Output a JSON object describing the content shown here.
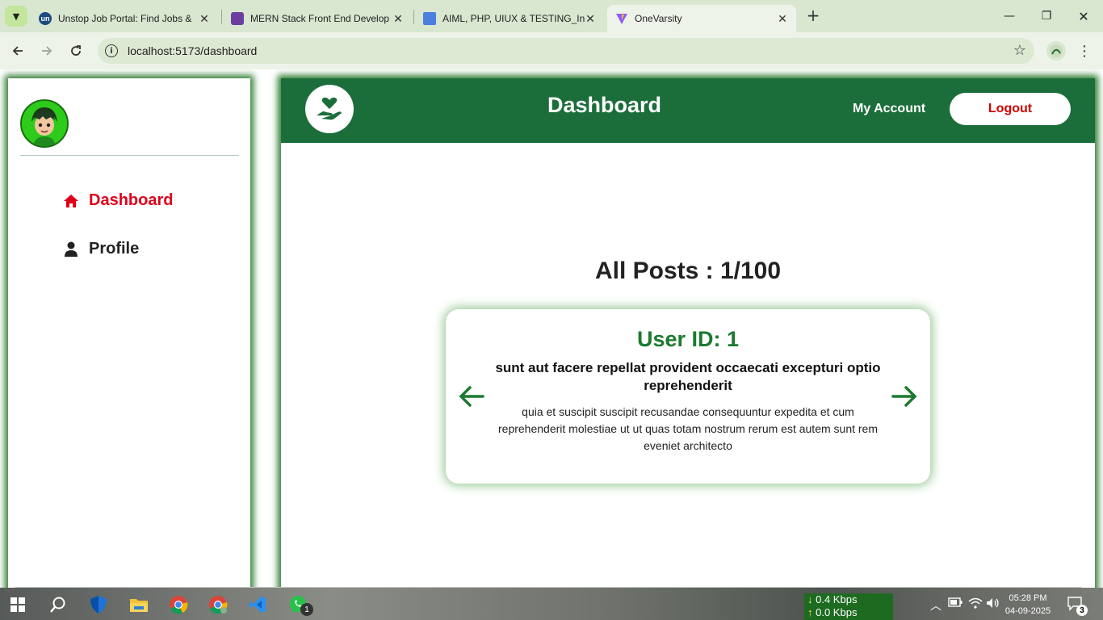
{
  "browser": {
    "tabs": [
      {
        "title": "Unstop Job Portal: Find Jobs &",
        "favicon_text": "un",
        "favicon_color": "#1c4980"
      },
      {
        "title": "MERN Stack Front End Develop",
        "favicon_color": "#6b3fa0"
      },
      {
        "title": "AIML, PHP, UIUX & TESTING_Int",
        "favicon_color": "#4a7fe0"
      },
      {
        "title": "OneVarsity",
        "favicon_color": "#f2b705"
      }
    ],
    "url": "localhost:5173/dashboard"
  },
  "sidebar": {
    "items": [
      {
        "label": "Dashboard",
        "icon": "home-icon",
        "color": "#e0001b"
      },
      {
        "label": "Profile",
        "icon": "user-icon",
        "color": "#222222"
      }
    ]
  },
  "header": {
    "title": "Dashboard",
    "my_account": "My Account",
    "logout": "Logout"
  },
  "posts": {
    "heading": "All Posts : 1/100",
    "card": {
      "user": "User ID: 1",
      "title": "sunt aut facere repellat provident occaecati excepturi optio reprehenderit",
      "body": "quia et suscipit suscipit recusandae consequuntur expedita et cum reprehenderit molestiae ut ut quas totam nostrum rerum est autem sunt rem eveniet architecto"
    }
  },
  "colors": {
    "accent": "#1b6e3a",
    "logout_text": "#d40000",
    "user_id": "#1b7a2e"
  },
  "taskbar": {
    "net_down": "0.4 Kbps",
    "net_up": "0.0 Kbps",
    "time": "05:28 PM",
    "date": "04-09-2025",
    "whatsapp_badge": "1",
    "notification_count": "3"
  }
}
